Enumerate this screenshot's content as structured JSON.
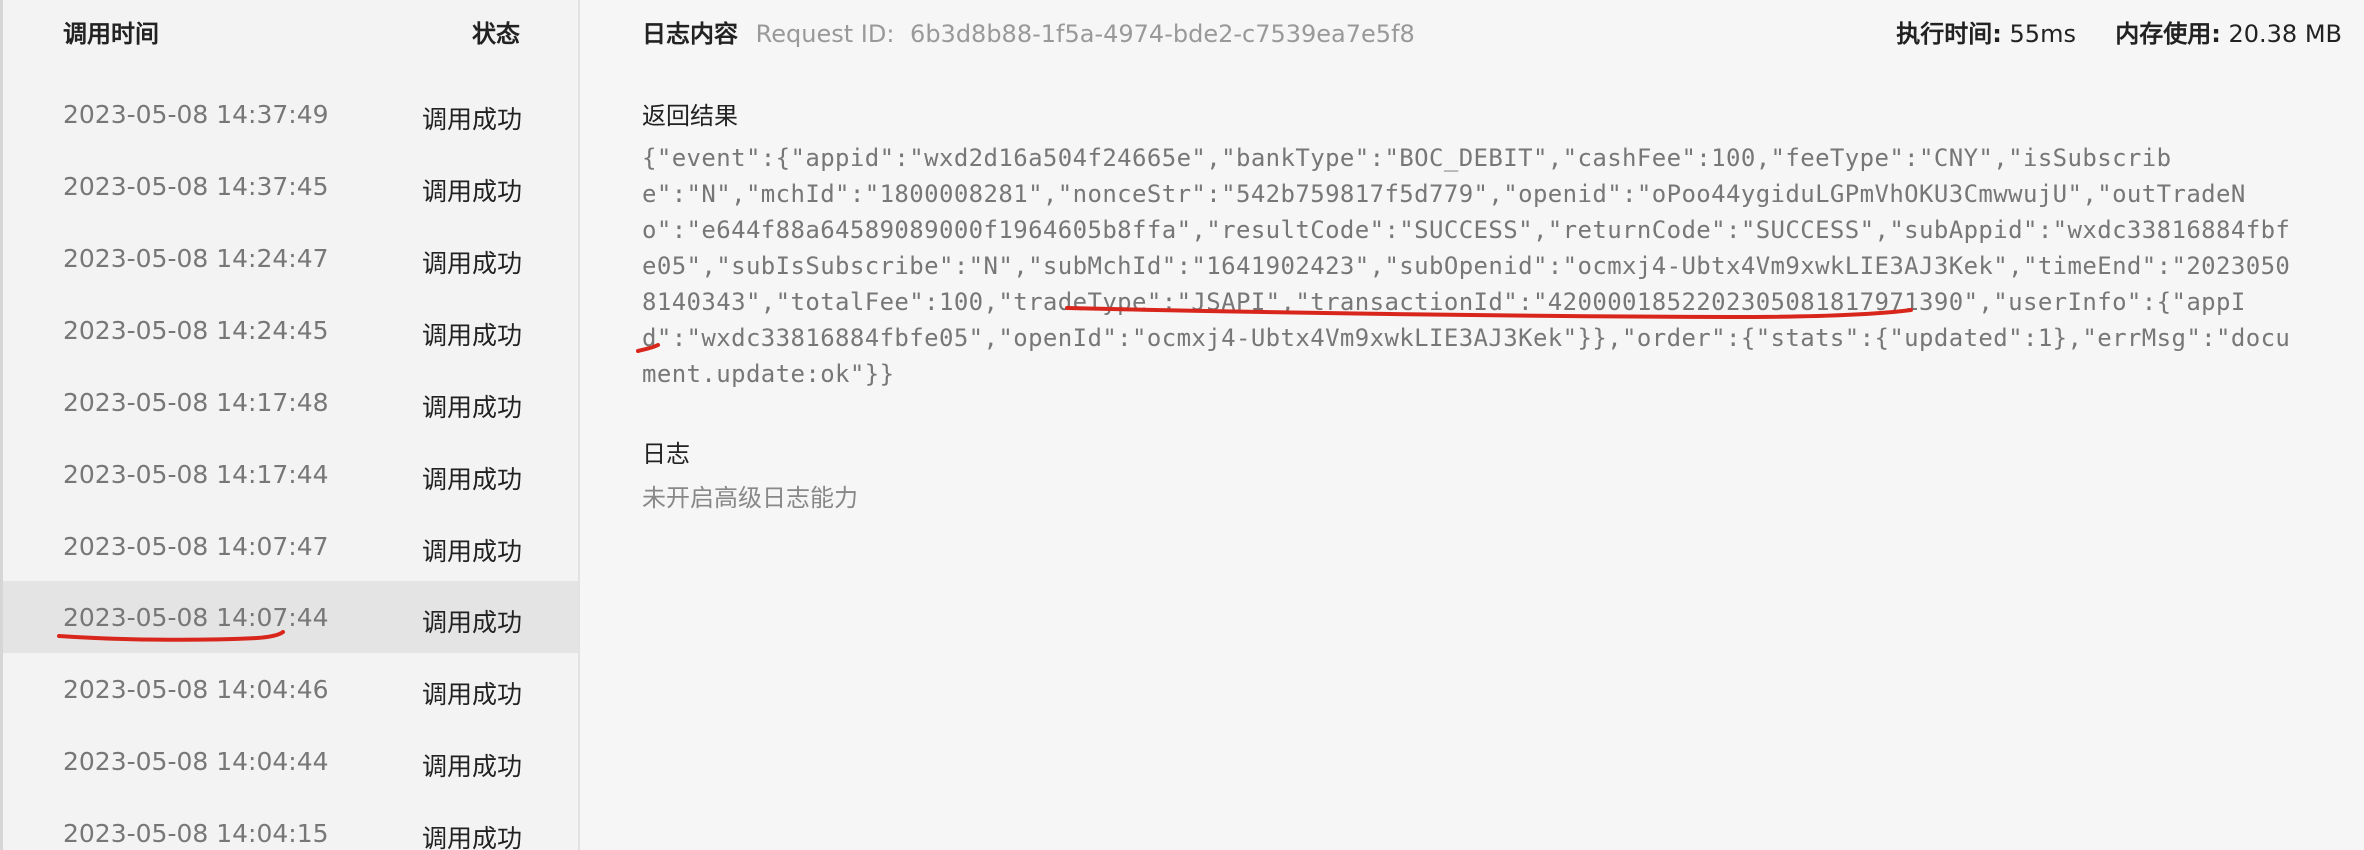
{
  "list": {
    "header_time": "调用时间",
    "header_status": "状态",
    "rows": [
      {
        "time": "2023-05-08 14:37:49",
        "status": "调用成功"
      },
      {
        "time": "2023-05-08 14:37:45",
        "status": "调用成功"
      },
      {
        "time": "2023-05-08 14:24:47",
        "status": "调用成功"
      },
      {
        "time": "2023-05-08 14:24:45",
        "status": "调用成功"
      },
      {
        "time": "2023-05-08 14:17:48",
        "status": "调用成功"
      },
      {
        "time": "2023-05-08 14:17:44",
        "status": "调用成功"
      },
      {
        "time": "2023-05-08 14:07:47",
        "status": "调用成功"
      },
      {
        "time": "2023-05-08 14:07:44",
        "status": "调用成功"
      },
      {
        "time": "2023-05-08 14:04:46",
        "status": "调用成功"
      },
      {
        "time": "2023-05-08 14:04:44",
        "status": "调用成功"
      },
      {
        "time": "2023-05-08 14:04:15",
        "status": "调用成功"
      }
    ],
    "selected_index": 7
  },
  "detail": {
    "title": "日志内容",
    "request_id_label": "Request ID:",
    "request_id": "6b3d8b88-1f5a-4974-bde2-c7539ea7e5f8",
    "exec_time_label": "执行时间:",
    "exec_time": "55ms",
    "memory_label": "内存使用:",
    "memory": "20.38 MB",
    "result_title": "返回结果",
    "result_body": "{\"event\":{\"appid\":\"wxd2d16a504f24665e\",\"bankType\":\"BOC_DEBIT\",\"cashFee\":100,\"feeType\":\"CNY\",\"isSubscribe\":\"N\",\"mchId\":\"1800008281\",\"nonceStr\":\"542b759817f5d779\",\"openid\":\"oPoo44ygiduLGPmVhOKU3CmwwujU\",\"outTradeNo\":\"e644f88a64589089000f1964605b8ffa\",\"resultCode\":\"SUCCESS\",\"returnCode\":\"SUCCESS\",\"subAppid\":\"wxdc33816884fbfe05\",\"subIsSubscribe\":\"N\",\"subMchId\":\"1641902423\",\"subOpenid\":\"ocmxj4-Ubtx4Vm9xwkLIE3AJ3Kek\",\"timeEnd\":\"20230508140343\",\"totalFee\":100,\"tradeType\":\"JSAPI\",\"transactionId\":\"4200001852202305081817971390\",\"userInfo\":{\"appId\":\"wxdc33816884fbfe05\",\"openId\":\"ocmxj4-Ubtx4Vm9xwkLIE3AJ3Kek\"}},\"order\":{\"stats\":{\"updated\":1},\"errMsg\":\"document.update:ok\"}}",
    "log_title": "日志",
    "log_note": "未开启高级日志能力"
  },
  "colors": {
    "annotation_red": "#d9261c",
    "selected_row": "#e4e4e4",
    "muted_text": "#777777"
  }
}
